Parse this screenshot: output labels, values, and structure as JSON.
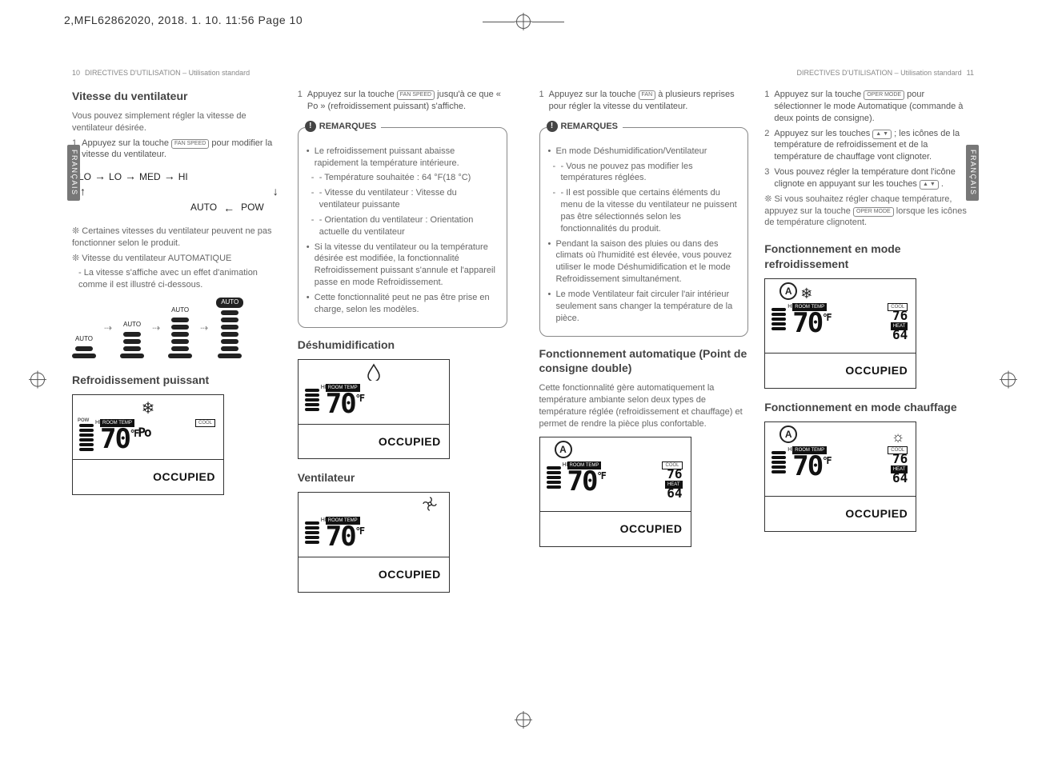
{
  "meta": {
    "jobline": "2,MFL62862020,    2018. 1. 10.    11:56  Page 10",
    "lang_tab": "FRANÇAIS"
  },
  "left_page": {
    "number": "10",
    "header": "DIRECTIVES D'UTILISATION – Utilisation standard",
    "col1": {
      "h_vitesse": "Vitesse du ventilateur",
      "p_vitesse_intro": "Vous pouvez simplement régler la vitesse de ventilateur désirée.",
      "step1_num": "1",
      "step1_a": "Appuyez sur la touche ",
      "step1_key": "FAN SPEED",
      "step1_b": " pour modifier la vitesse du ventilateur.",
      "flow": {
        "slo": "SLO",
        "lo": "LO",
        "med": "MED",
        "hi": "HI",
        "auto": "AUTO",
        "pow": "POW"
      },
      "note1": "❊ Certaines vitesses du ventilateur peuvent ne pas fonctionner selon le produit.",
      "note2a": "❊ Vitesse du ventilateur AUTOMATIQUE",
      "note2b": "- La vitesse s'affiche avec un effet d'animation comme il est illustré ci-dessous.",
      "auto_label": "AUTO",
      "h_refroid": "Refroidissement puissant",
      "lcd_refroid": {
        "mode_icon": "❄",
        "pow": "POW",
        "room_temp": "ROOM TEMP",
        "cool": "COOL",
        "temp": "70",
        "unit": "°F",
        "po": "Po",
        "occupied": "OCCUPIED"
      }
    },
    "col2": {
      "step1_num": "1",
      "step1_a": "Appuyez sur la touche ",
      "step1_key": "FAN SPEED",
      "step1_b": " jusqu'à ce que « Po » (refroidissement puissant) s'affiche.",
      "remarques_title": "REMARQUES",
      "remarques": [
        "Le refroidissement puissant abaisse rapidement la température intérieure.",
        "- Température souhaitée : 64 °F(18 °C)",
        "- Vitesse du ventilateur : Vitesse du ventilateur puissante",
        "- Orientation du ventilateur : Orientation actuelle du ventilateur",
        "Si la vitesse du ventilateur ou la température désirée est modifiée, la fonctionnalité Refroidissement puissant s'annule et l'appareil passe en mode Refroidissement.",
        "Cette fonctionnalité peut ne pas être prise en charge, selon les modèles."
      ],
      "h_deshum": "Déshumidification",
      "lcd_deshum": {
        "mode_icon": "💧",
        "room_temp": "ROOM TEMP",
        "temp": "70",
        "unit": "°F",
        "occupied": "OCCUPIED"
      },
      "h_vent": "Ventilateur",
      "lcd_vent": {
        "mode_icon": "⚙",
        "room_temp": "ROOM TEMP",
        "temp": "70",
        "unit": "°F",
        "occupied": "OCCUPIED"
      }
    }
  },
  "right_page": {
    "number": "11",
    "header": "DIRECTIVES D'UTILISATION – Utilisation standard",
    "col1": {
      "step1_num": "1",
      "step1_a": "Appuyez sur la touche ",
      "step1_key": "FAN",
      "step1_b": " à plusieurs reprises pour régler la vitesse du ventilateur.",
      "remarques_title": "REMARQUES",
      "remarques": [
        "En mode Déshumidification/Ventilateur",
        "- Vous ne pouvez pas modifier les températures réglées.",
        "- Il est possible que certains éléments du menu de la vitesse du ventilateur ne puissent pas être sélectionnés selon les fonctionnalités du produit.",
        "Pendant la saison des pluies ou dans des climats où l'humidité est élevée, vous pouvez utiliser le mode Déshumidification et le mode Refroidissement simultanément.",
        "Le mode Ventilateur fait circuler l'air intérieur seulement sans changer la température de la pièce."
      ],
      "h_auto": "Fonctionnement automatique (Point de consigne double)",
      "p_auto": "Cette fonctionnalité gère automatiquement la température ambiante selon deux types de température réglée (refroidissement et chauffage) et permet de rendre la pièce plus confortable.",
      "lcd_auto": {
        "auto": "A",
        "room_temp": "ROOM TEMP",
        "cool": "COOL",
        "heat": "HEAT",
        "temp": "70",
        "unit": "°F",
        "cool_val": "76",
        "heat_val": "64",
        "occupied": "OCCUPIED"
      }
    },
    "col2": {
      "step1_num": "1",
      "step1_a": "Appuyez sur la touche ",
      "step1_key": "OPER MODE",
      "step1_b": " pour sélectionner le mode Automatique (commande à deux points de consigne).",
      "step2_num": "2",
      "step2_a": "Appuyez sur les touches ",
      "step2_key": "▲ ▼",
      "step2_b": " ; les icônes de la température de refroidissement et de la température de chauffage vont clignoter.",
      "step3_num": "3",
      "step3_a": "Vous pouvez régler la température dont l'icône clignote en appuyant sur les touches ",
      "step3_key": "▲ ▼",
      "step3_b": " .",
      "note": "❊ Si vous souhaitez régler chaque température, appuyez sur la touche ",
      "note_key": "OPER MODE",
      "note_b": " lorsque les icônes de température clignotent.",
      "h_cool": "Fonctionnement en mode refroidissement",
      "lcd_cool": {
        "auto": "A",
        "snow": "❄",
        "room_temp": "ROOM TEMP",
        "cool": "COOL",
        "heat": "HEAT",
        "temp": "70",
        "unit": "°F",
        "cool_val": "76",
        "heat_val": "64",
        "occupied": "OCCUPIED"
      },
      "h_heat": "Fonctionnement en mode chauffage",
      "lcd_heat": {
        "auto": "A",
        "sun": "☼",
        "room_temp": "ROOM TEMP",
        "cool": "COOL",
        "heat": "HEAT",
        "temp": "70",
        "unit": "°F",
        "cool_val": "76",
        "heat_val": "64",
        "occupied": "OCCUPIED"
      }
    }
  }
}
